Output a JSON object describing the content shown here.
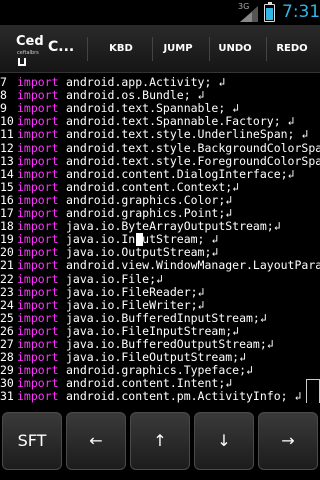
{
  "status_bar": {
    "network": "3G",
    "time": "7:31",
    "battery_level": 0.85,
    "accent_color": "#33b5e5"
  },
  "action_bar": {
    "app_icon_text": "Ced",
    "app_icon_subtext": "ceftalbrs",
    "title": "C...",
    "buttons": [
      "KBD",
      "JUMP",
      "UNDO",
      "REDO"
    ]
  },
  "editor": {
    "keyword_color": "#ff33ff",
    "lines": [
      {
        "num": "7",
        "kw": "import",
        "code": "android.app.Activity; ↲"
      },
      {
        "num": "8",
        "kw": "import",
        "code": "android.os.Bundle; ↲"
      },
      {
        "num": "9",
        "kw": "import",
        "code": "android.text.Spannable; ↲"
      },
      {
        "num": "10",
        "kw": "import",
        "code": "android.text.Spannable.Factory; ↲"
      },
      {
        "num": "11",
        "kw": "import",
        "code": "android.text.style.UnderlineSpan; ↲"
      },
      {
        "num": "12",
        "kw": "import",
        "code": "android.text.style.BackgroundColorSpa"
      },
      {
        "num": "13",
        "kw": "import",
        "code": "android.text.style.ForegroundColorSpa"
      },
      {
        "num": "14",
        "kw": "import",
        "code": "android.content.DialogInterface;↲"
      },
      {
        "num": "15",
        "kw": "import",
        "code": "android.content.Context;↲"
      },
      {
        "num": "16",
        "kw": "import",
        "code": "android.graphics.Color;↲"
      },
      {
        "num": "17",
        "kw": "import",
        "code": "android.graphics.Point;↲"
      },
      {
        "num": "18",
        "kw": "import",
        "code": "java.io.ByteArrayOutputStream;↲"
      },
      {
        "num": "19",
        "kw": "import",
        "code": "java.io.InputStream; ↲"
      },
      {
        "num": "20",
        "kw": "import",
        "code": "java.io.OutputStream;↲"
      },
      {
        "num": "21",
        "kw": "import",
        "code": "android.view.WindowManager.LayoutPara"
      },
      {
        "num": "22",
        "kw": "import",
        "code": "java.io.File;↲"
      },
      {
        "num": "23",
        "kw": "import",
        "code": "java.io.FileReader;↲"
      },
      {
        "num": "24",
        "kw": "import",
        "code": "java.io.FileWriter;↲"
      },
      {
        "num": "25",
        "kw": "import",
        "code": "java.io.BufferedInputStream;↲"
      },
      {
        "num": "26",
        "kw": "import",
        "code": "java.io.FileInputStream;↲"
      },
      {
        "num": "27",
        "kw": "import",
        "code": "java.io.BufferedOutputStream;↲"
      },
      {
        "num": "28",
        "kw": "import",
        "code": "java.io.FileOutputStream;↲"
      },
      {
        "num": "29",
        "kw": "import",
        "code": "android.graphics.Typeface;↲"
      },
      {
        "num": "30",
        "kw": "import",
        "code": "android.content.Intent;↲"
      },
      {
        "num": "31",
        "kw": "import",
        "code": "android.content.pm.ActivityInfo; ↲"
      }
    ]
  },
  "keys": [
    "SFT",
    "←",
    "↑",
    "↓",
    "→"
  ]
}
